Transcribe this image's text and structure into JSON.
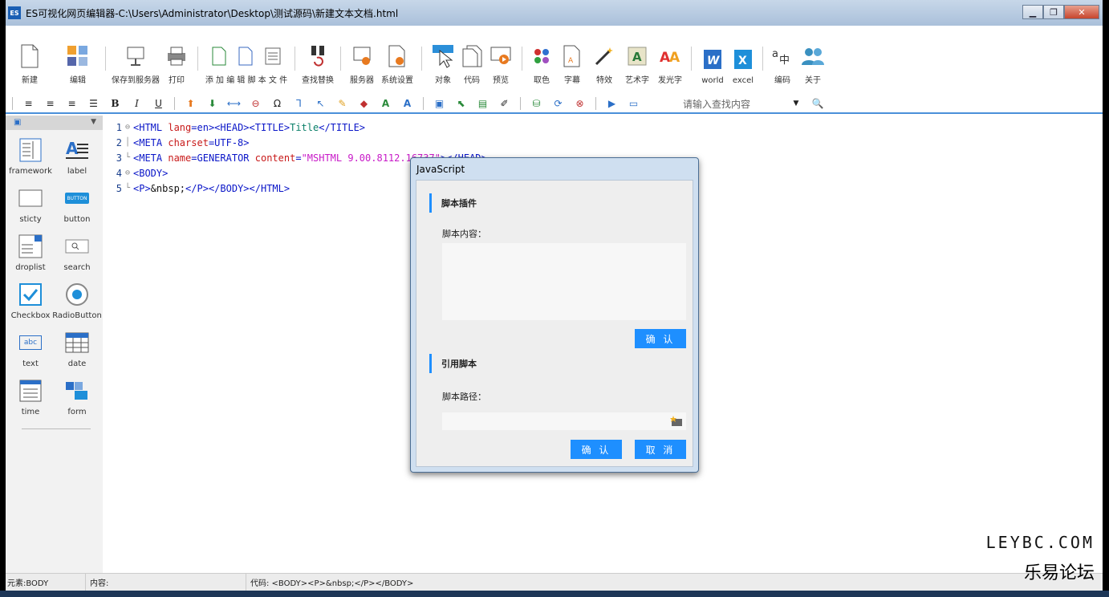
{
  "window": {
    "title": "ES可视化网页编辑器-C:\\Users\\Administrator\\Desktop\\测试源码\\新建文本文档.html",
    "app_badge": "ES"
  },
  "ribbon": [
    {
      "label": "新建",
      "icon": "new-file-icon"
    },
    {
      "label": "编辑",
      "icon": "edit-icon"
    },
    {
      "label": "保存到服务器",
      "icon": "save-to-server-icon"
    },
    {
      "label": "打印",
      "icon": "print-icon"
    },
    {
      "label": "添 加 编 辑 脚 本 文 件",
      "icon": "script-file-icon"
    },
    {
      "label": "查找替换",
      "icon": "find-replace-icon"
    },
    {
      "label": "服务器",
      "icon": "server-icon"
    },
    {
      "label": "系统设置",
      "icon": "settings-icon"
    },
    {
      "label": "对象",
      "icon": "object-icon"
    },
    {
      "label": "代码",
      "icon": "code-icon"
    },
    {
      "label": "预览",
      "icon": "preview-icon"
    },
    {
      "label": "取色",
      "icon": "color-picker-icon"
    },
    {
      "label": "字幕",
      "icon": "subtitle-icon"
    },
    {
      "label": "特效",
      "icon": "effect-icon"
    },
    {
      "label": "艺术字",
      "icon": "art-text-icon"
    },
    {
      "label": "发光字",
      "icon": "glow-text-icon"
    },
    {
      "label": "world",
      "icon": "word-icon"
    },
    {
      "label": "excel",
      "icon": "excel-icon"
    },
    {
      "label": "编码",
      "icon": "encoding-icon"
    },
    {
      "label": "关于",
      "icon": "about-icon"
    }
  ],
  "toolbar2": {
    "search_placeholder": "请输入查找内容"
  },
  "sidebar": [
    {
      "label": "framework",
      "icon": "framework-icon"
    },
    {
      "label": "label",
      "icon": "label-icon"
    },
    {
      "label": "sticty",
      "icon": "sticky-icon"
    },
    {
      "label": "button",
      "icon": "button-icon",
      "text": "BUTTON"
    },
    {
      "label": "droplist",
      "icon": "droplist-icon"
    },
    {
      "label": "search",
      "icon": "search-icon"
    },
    {
      "label": "Checkbox",
      "icon": "checkbox-icon"
    },
    {
      "label": "RadioButton",
      "icon": "radio-icon"
    },
    {
      "label": "text",
      "icon": "text-icon",
      "text": "abc"
    },
    {
      "label": "date",
      "icon": "date-icon"
    },
    {
      "label": "time",
      "icon": "time-icon"
    },
    {
      "label": "form",
      "icon": "form-icon"
    }
  ],
  "code": {
    "line_numbers": [
      "1",
      "2",
      "3",
      "4",
      "5"
    ],
    "l1": {
      "t1": "<HTML ",
      "a1": "lang",
      "eq": "=en>",
      "t2": "<HEAD><TITLE>",
      "text": "Title",
      "t3": "</TITLE>"
    },
    "l2": {
      "t1": "<META ",
      "a1": "charset",
      "eq": "=UTF-8>"
    },
    "l3": {
      "t1": "<META ",
      "a1": "name",
      "eq": "=GENERATOR ",
      "a2": "content",
      "eq2": "=",
      "v": "\"MSHTML 9.00.8112.16737\"",
      "t2": "></HEAD>"
    },
    "l4": {
      "t1": "<BODY>"
    },
    "l5": {
      "t1": "<P>",
      "text": "&nbsp;",
      "t2": "</P></BODY></HTML>"
    }
  },
  "dialog": {
    "title": "JavaScript",
    "section1": "脚本插件",
    "content_label": "脚本内容：",
    "confirm1": "确 认",
    "section2": "引用脚本",
    "path_label": "脚本路径：",
    "confirm2": "确 认",
    "cancel": "取 消"
  },
  "status": {
    "element": "元素:BODY",
    "content": "内容:",
    "code": "代码:  <BODY><P>&nbsp;</P></BODY>"
  },
  "watermark": {
    "line1": "LEYBC.COM",
    "line2": "乐易论坛"
  },
  "colors": {
    "accent": "#1e8fff",
    "tag": "#0a16c8",
    "attr": "#c81a1a",
    "value": "#c81ac8"
  }
}
